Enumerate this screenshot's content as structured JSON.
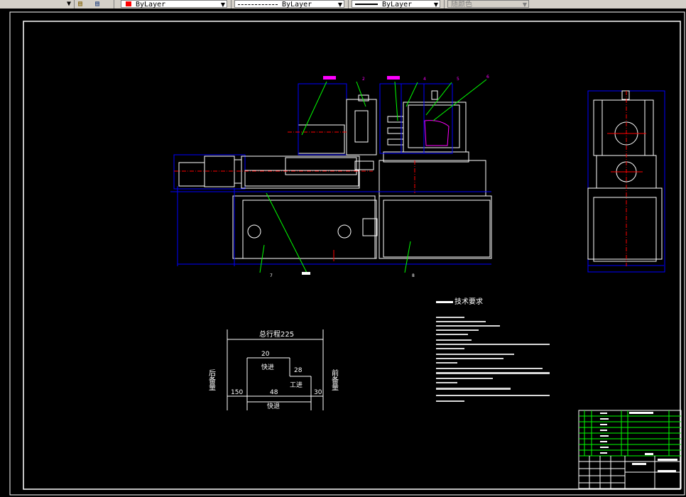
{
  "toolbar": {
    "layer_color_label": "ByLayer",
    "linetype_label": "ByLayer",
    "lineweight_label": "ByLayer",
    "plot_style_label": "随颜色",
    "colors": {
      "red_swatch": "#ff0000",
      "toolbar_bg": "#d4d0c8"
    }
  },
  "drawing": {
    "background": "#000000",
    "colors": {
      "outline": "#ffffff",
      "dimension": "#0000ff",
      "leader": "#00ff00",
      "centerline": "#ff0000",
      "balloon": "#ff00ff",
      "cyan_part": "#00ffff"
    },
    "balloon_labels": [
      "1",
      "2",
      "3",
      "4",
      "5",
      "6",
      "7",
      "8"
    ],
    "left_label": "后备量",
    "right_label": "前备量",
    "stroke_diagram": {
      "total_label": "总行程225",
      "fast_forward_label": "快进",
      "work_feed_label": "工进",
      "fast_back_label": "快退",
      "values": {
        "total": 225,
        "fast_forward": 20,
        "work_feed": 28,
        "fast_back": 48,
        "rear_reserve": 150,
        "front_reserve": 30
      }
    },
    "technical_requirements_title": "技术要求"
  }
}
